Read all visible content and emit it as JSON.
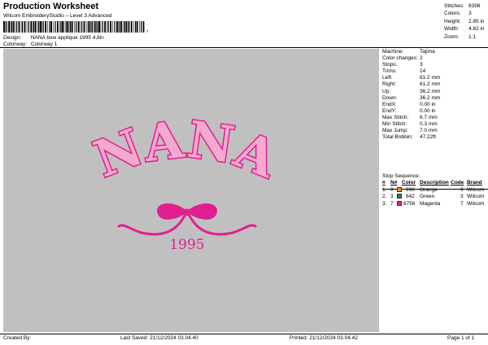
{
  "header": {
    "title": "Production Worksheet",
    "subtitle": "Wilcom EmbroideryStudio – Level 3 Advanced",
    "barcode_trailer": ",",
    "design_label": "Design:",
    "design_value": "NANA bow applique 1995 4,8in",
    "colorway_label": "Colorway:",
    "colorway_value": "Colorway 1"
  },
  "top_stats": [
    {
      "label": "Stitches:",
      "value": "8398"
    },
    {
      "label": "Colors:",
      "value": "3"
    },
    {
      "label": "Height:",
      "value": "2.85 in"
    },
    {
      "label": "Width:",
      "value": "4.82 in"
    },
    {
      "label": "Zoom:",
      "value": "1:1"
    }
  ],
  "design_art": {
    "word": "NANA",
    "year": "1995",
    "colors": {
      "fill": "#f4a9ce",
      "outline": "#e21f8e",
      "background": "#c0c0c0"
    }
  },
  "machine_info": [
    {
      "label": "Machine:",
      "value": "Tajima"
    },
    {
      "label": "Color changes:",
      "value": "2"
    },
    {
      "label": "Stops:",
      "value": "3"
    },
    {
      "label": "Trims:",
      "value": "14"
    },
    {
      "label": "Left:",
      "value": "61.2 mm"
    },
    {
      "label": "Right:",
      "value": "61.2 mm"
    },
    {
      "label": "Up:",
      "value": "36.2 mm"
    },
    {
      "label": "Down:",
      "value": "36.2 mm"
    },
    {
      "label": "EndX:",
      "value": "0.00 in"
    },
    {
      "label": "EndY:",
      "value": "0.00 in"
    },
    {
      "label": "Max Stitch:",
      "value": "6.7 mm"
    },
    {
      "label": "Min Stitch:",
      "value": "0.3 mm"
    },
    {
      "label": "Max Jump:",
      "value": "7.0 mm"
    },
    {
      "label": "Total Bobbin:",
      "value": "47.22ft"
    }
  ],
  "stop_sequence": {
    "title": "Stop Sequence:",
    "columns": [
      "#",
      "N#",
      "Color",
      "Description",
      "Code",
      "Brand"
    ],
    "rows": [
      {
        "index": "1.",
        "n": "9",
        "color_code": "998",
        "swatch": "#f28e2b",
        "description": "Orange",
        "code": "9",
        "brand": "Wilcom"
      },
      {
        "index": "2.",
        "n": "3",
        "color_code": "642",
        "swatch": "#1d8a3a",
        "description": "Green",
        "code": "3",
        "brand": "Wilcom"
      },
      {
        "index": "3.",
        "n": "7",
        "color_code": "6756",
        "swatch": "#e21f8e",
        "description": "Magenta",
        "code": "7",
        "brand": "Wilcom"
      }
    ]
  },
  "footer": {
    "created_by": "Created By:",
    "last_saved": "Last Saved: 21/12/2024 03.04.40",
    "printed": "Printed: 21/12/2024 03.04.42",
    "page": "Page 1 of 1"
  }
}
